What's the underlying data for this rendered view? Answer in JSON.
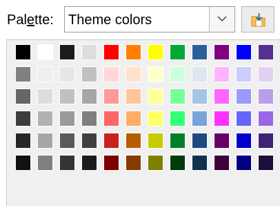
{
  "palette_selector": {
    "label_before_accel": "Pal",
    "label_accel": "e",
    "label_after_accel": "tte:",
    "selected": "Theme colors"
  },
  "icons": {
    "dropdown": "chevron-down-icon",
    "import": "import-palette-icon"
  },
  "colors": {
    "accent": "#e89a2c",
    "panel_bg": "#f0f0f0"
  },
  "swatch_rows": [
    [
      "#000000",
      "#ffffff",
      "#1c1c1c",
      "#dddddd",
      "#ff0000",
      "#ff8000",
      "#ffff00",
      "#00a933",
      "#2a6099",
      "#800080",
      "#0000ff",
      "#55308d"
    ],
    [
      "#808080",
      "#eeeeee",
      "#e6e6e6",
      "#c0c0c0",
      "#ffd7d7",
      "#ffe2cc",
      "#ffffcc",
      "#ccffdd",
      "#dee6ef",
      "#ffb3ff",
      "#ccccff",
      "#e0d2f0"
    ],
    [
      "#666666",
      "#dddddd",
      "#c0c0c0",
      "#a6a6a6",
      "#ff9999",
      "#ffc499",
      "#ffff99",
      "#77ff99",
      "#a6c4e6",
      "#ff66ff",
      "#9999ff",
      "#b99ee8"
    ],
    [
      "#3d3d3d",
      "#b2b2b2",
      "#999999",
      "#7f7f7f",
      "#ff6666",
      "#ffad66",
      "#ffff66",
      "#33ff77",
      "#7aa3d8",
      "#ff33ff",
      "#6666ff",
      "#9966e6"
    ],
    [
      "#262626",
      "#a6a6a6",
      "#595959",
      "#404040",
      "#c9211e",
      "#b85c00",
      "#c9c900",
      "#008029",
      "#1e4a80",
      "#660066",
      "#0000cc",
      "#3f2377"
    ],
    [
      "#111111",
      "#808080",
      "#333333",
      "#1c1c1c",
      "#7f0000",
      "#843c04",
      "#808000",
      "#003b0d",
      "#11324e",
      "#3c003c",
      "#000080",
      "#1c0f3b"
    ]
  ]
}
